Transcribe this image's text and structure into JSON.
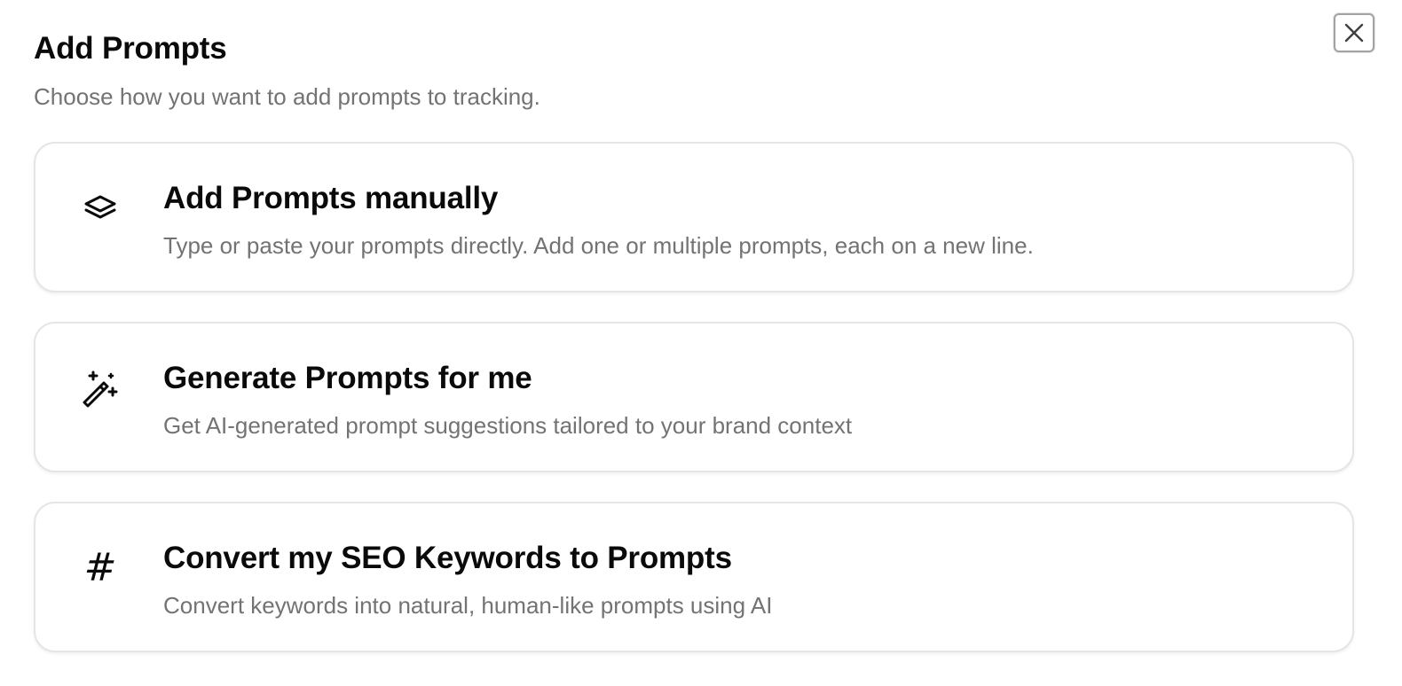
{
  "dialog": {
    "title": "Add Prompts",
    "subtitle": "Choose how you want to add prompts to tracking.",
    "close_icon": "close-icon"
  },
  "options": [
    {
      "icon": "layers-icon",
      "title": "Add Prompts manually",
      "description": "Type or paste your prompts directly. Add one or multiple prompts, each on a new line."
    },
    {
      "icon": "magic-wand-icon",
      "title": "Generate Prompts for me",
      "description": "Get AI-generated prompt suggestions tailored to your brand context"
    },
    {
      "icon": "hash-icon",
      "title": "Convert my SEO Keywords to Prompts",
      "description": "Convert keywords into natural, human-like prompts using AI",
      "icon_glyph": "#"
    }
  ],
  "colors": {
    "text_primary": "#0a0a0a",
    "text_muted": "#737373",
    "border": "#e5e5e5",
    "background": "#ffffff"
  }
}
